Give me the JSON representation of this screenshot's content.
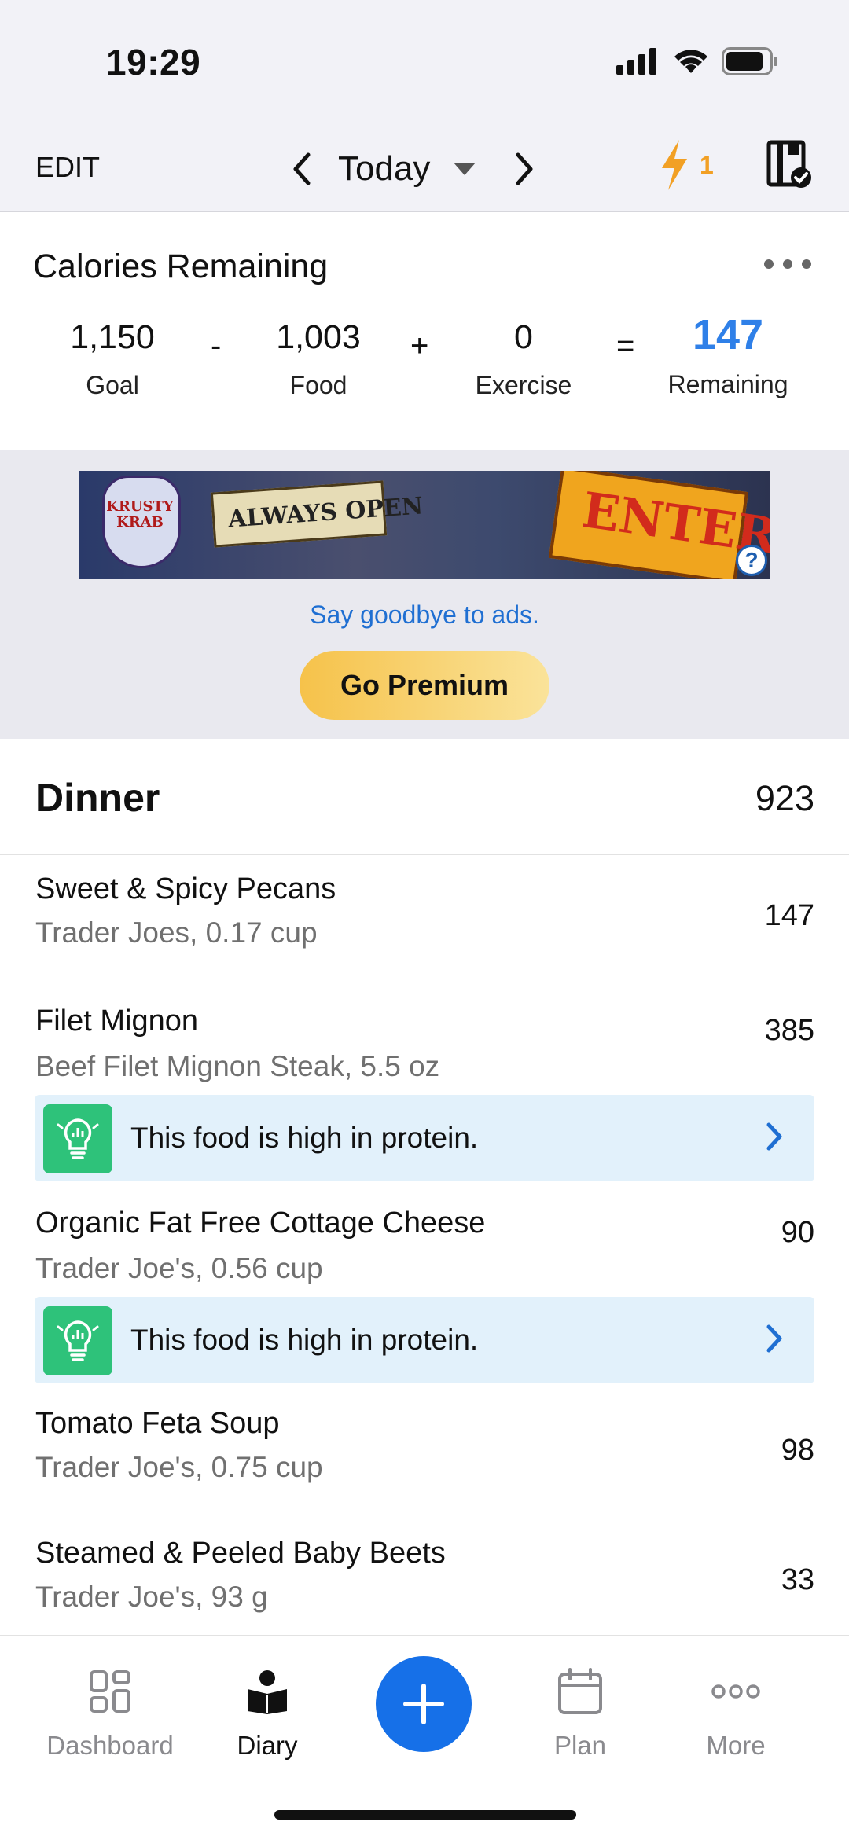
{
  "status_bar": {
    "time": "19:29"
  },
  "nav": {
    "edit_label": "EDIT",
    "date_label": "Today",
    "streak_count": "1"
  },
  "summary": {
    "title": "Calories Remaining",
    "goal_value": "1,150",
    "goal_label": "Goal",
    "minus": "-",
    "food_value": "1,003",
    "food_label": "Food",
    "plus": "+",
    "exercise_value": "0",
    "exercise_label": "Exercise",
    "equals": "=",
    "remaining_value": "147",
    "remaining_label": "Remaining",
    "accent_color": "#2f80e8"
  },
  "ad": {
    "sign_text": "KRUSTY KRAB",
    "banner_text": "ALWAYS OPEN",
    "enter_text": "ENTER",
    "help_glyph": "?",
    "goodbye_text": "Say goodbye to ads.",
    "premium_label": "Go Premium"
  },
  "meal": {
    "title": "Dinner",
    "total": "923",
    "items": [
      {
        "name": "Sweet & Spicy Pecans",
        "desc": "Trader Joes, 0.17 cup",
        "cal": "147"
      },
      {
        "name": "Filet Mignon",
        "desc": "Beef Filet Mignon Steak, 5.5 oz",
        "cal": "385",
        "insight": "This food is high in protein."
      },
      {
        "name": "Organic Fat Free Cottage Cheese",
        "desc": "Trader Joe's, 0.56 cup",
        "cal": "90",
        "insight": "This food is high in protein."
      },
      {
        "name": "Tomato Feta Soup",
        "desc": "Trader Joe's, 0.75 cup",
        "cal": "98"
      },
      {
        "name": "Steamed & Peeled Baby Beets",
        "desc": "Trader Joe's, 93 g",
        "cal": "33"
      }
    ]
  },
  "tabs": {
    "dashboard": "Dashboard",
    "diary": "Diary",
    "plan": "Plan",
    "more": "More"
  }
}
